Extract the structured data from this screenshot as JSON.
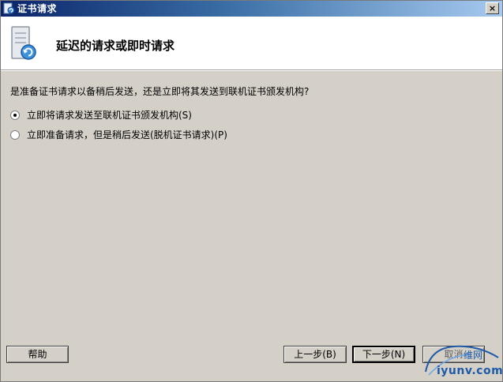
{
  "window": {
    "title": "证书请求",
    "close_label": "×"
  },
  "header": {
    "title": "延迟的请求或即时请求"
  },
  "main": {
    "prompt": "是准备证书请求以备稍后发送，还是立即将其发送到联机证书颁发机构?",
    "options": [
      {
        "label": "立即将请求发送至联机证书颁发机构(S)",
        "checked": true
      },
      {
        "label": "立即准备请求，但是稍后发送(脱机证书请求)(P)",
        "checked": false
      }
    ]
  },
  "footer": {
    "help_label": "帮助",
    "back_label": "上一步(B)",
    "next_label": "下一步(N)",
    "cancel_label": "取消"
  },
  "watermark": {
    "site_text": "维网",
    "url_text": "iyunv.com"
  },
  "colors": {
    "titlebar_start": "#0a246a",
    "face": "#d4d0c8",
    "watermark": "#1e5aa8"
  },
  "icons": {
    "title": "certificate-request-icon",
    "header": "server-request-icon",
    "close": "close-icon"
  }
}
